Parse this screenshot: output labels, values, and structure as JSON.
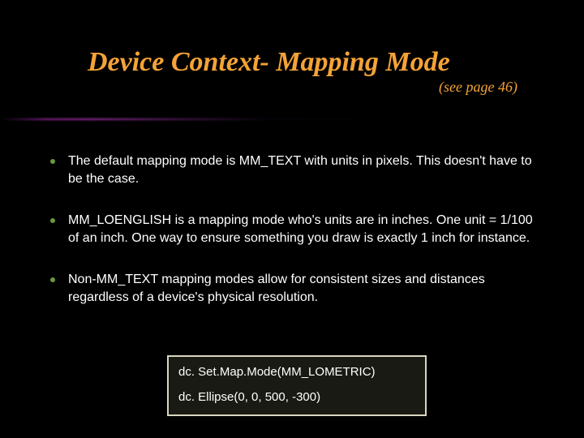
{
  "title": "Device Context- Mapping Mode",
  "subtitle": "(see page 46)",
  "bullets": [
    "The default mapping mode is MM_TEXT  with units in pixels. This doesn't have to be the case.",
    "MM_LOENGLISH is a mapping mode who's units are in inches. One unit = 1/100 of an inch.  One way to ensure something you draw is exactly 1 inch for instance.",
    "Non-MM_TEXT mapping modes allow for consistent sizes and distances regardless of a device's physical resolution."
  ],
  "code": {
    "line1": "dc. Set.Map.Mode(MM_LOMETRIC)",
    "line2": "dc. Ellipse(0, 0, 500, -300)"
  },
  "colors": {
    "title": "#f4a336",
    "bullet_dot": "#6a9a3a",
    "background": "#000000"
  }
}
